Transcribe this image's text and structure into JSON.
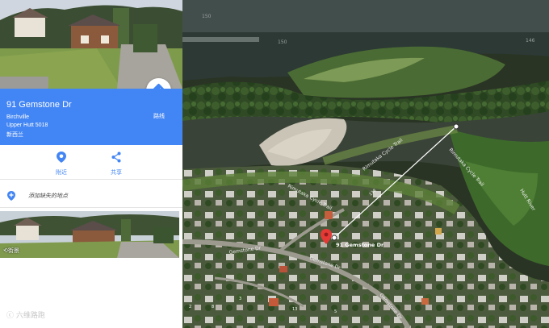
{
  "place": {
    "name": "91 Gemstone Dr",
    "line1": "Birchville",
    "line2": "Upper Hutt 5018",
    "line3": "新西兰"
  },
  "actions": {
    "route": "路线",
    "nearby": "附近",
    "share": "共享",
    "add_missing": "添加缺失的地点"
  },
  "street_view_label": "街景",
  "watermark": "六维路跑",
  "map": {
    "scale_labels": [
      "150",
      "146",
      "138",
      "96"
    ],
    "trail_labels": [
      "Rimutaka Cycle Trail",
      "Rimutaka Cycle Trail",
      "Rimutaka Cycle Trail"
    ],
    "roads": [
      "Gemstone Dr",
      "Gemstone Dr",
      "Gemstone Dr",
      "Hutt River"
    ],
    "pin_label": "91 Gemstone Dr",
    "house_numbers": [
      "2",
      "8",
      "13",
      "3",
      "5"
    ]
  },
  "colors": {
    "header_blue": "#4285f4",
    "pin_red": "#e53935",
    "measure_line": "#ffffff"
  },
  "icons": {
    "route": "directions-icon",
    "nearby": "place-pin-icon",
    "share": "share-icon",
    "add_place": "add-location-icon"
  }
}
